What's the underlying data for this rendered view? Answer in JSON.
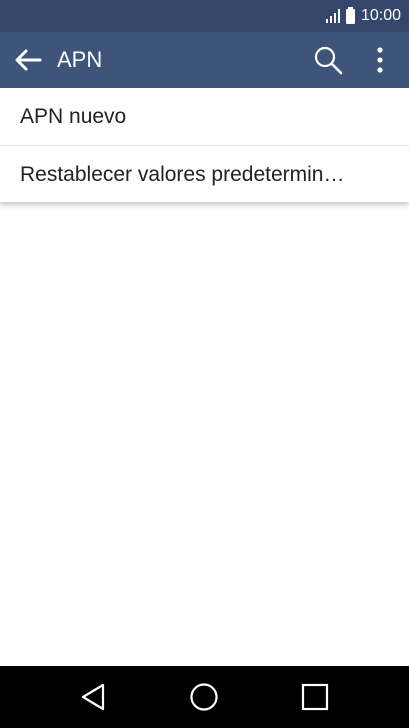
{
  "status_bar": {
    "time": "10:00",
    "signal_icon": "signal-icon",
    "battery_icon": "battery-icon"
  },
  "app_bar": {
    "title": "APN",
    "back_icon": "arrow-back-icon",
    "search_icon": "search-icon",
    "more_icon": "more-vert-icon"
  },
  "menu": {
    "items": [
      {
        "label": "APN nuevo"
      },
      {
        "label": "Restablecer valores predetermin…"
      }
    ]
  },
  "nav_bar": {
    "back_icon": "nav-back-icon",
    "home_icon": "nav-home-icon",
    "recents_icon": "nav-recents-icon"
  },
  "colors": {
    "status_bar": "#34466a",
    "app_bar": "#3f5479",
    "nav_bar": "#000000"
  }
}
